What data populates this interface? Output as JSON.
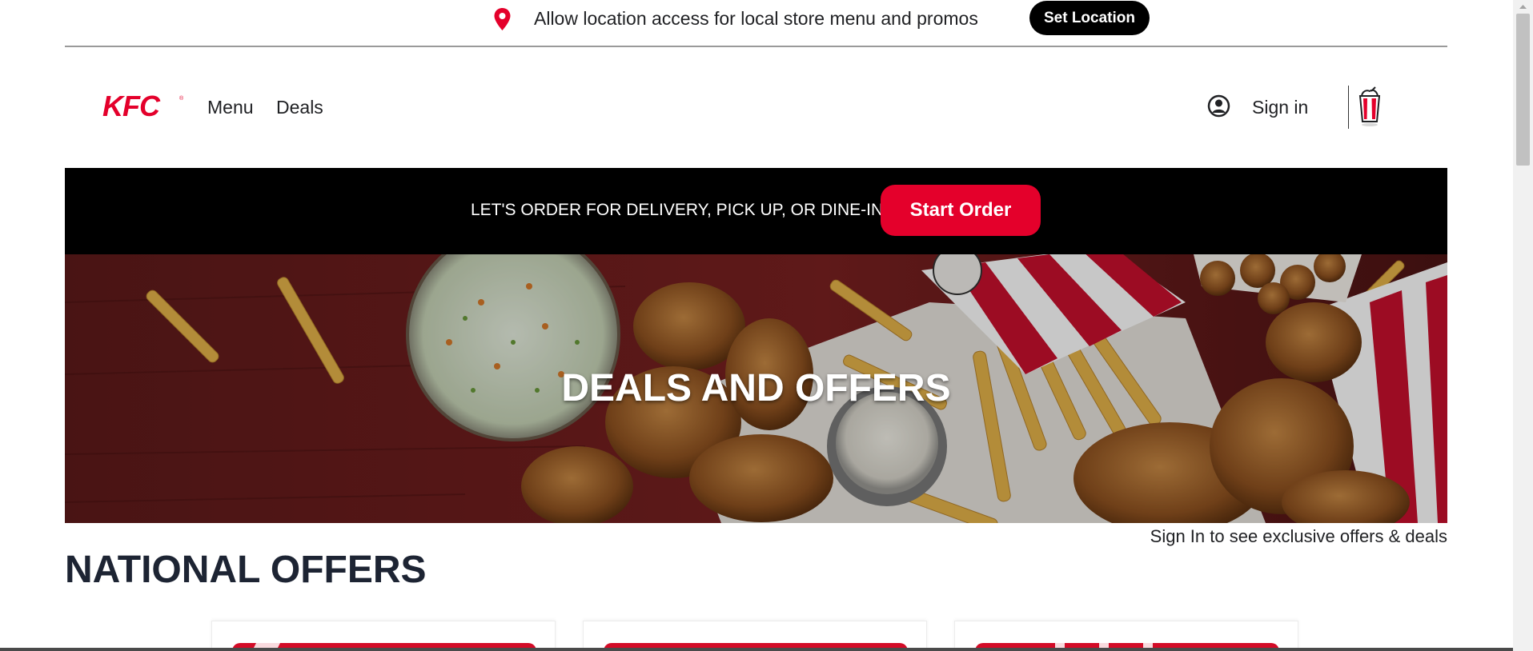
{
  "location_banner": {
    "message": "Allow location access for local store menu and promos",
    "button_label": "Set Location",
    "icon": "map-pin-icon"
  },
  "header": {
    "logo_text": "KFC",
    "nav": [
      {
        "label": "Menu"
      },
      {
        "label": "Deals"
      }
    ],
    "sign_in_label": "Sign in",
    "account_icon": "account-circle-icon",
    "cart_icon": "bucket-cart-icon"
  },
  "order_bar": {
    "message": "LET'S ORDER FOR DELIVERY, PICK UP, OR DINE-IN",
    "button_label": "Start Order"
  },
  "hero": {
    "title": "DEALS AND OFFERS"
  },
  "exclusive_link": "Sign In to see exclusive offers & deals",
  "section_title": "NATIONAL OFFERS",
  "offers": [
    {
      "name": "offer-card-1"
    },
    {
      "name": "offer-card-2"
    },
    {
      "name": "offer-card-3"
    }
  ],
  "colors": {
    "brand_red": "#e4002b",
    "black": "#000000",
    "text_dark": "#1d2433"
  }
}
